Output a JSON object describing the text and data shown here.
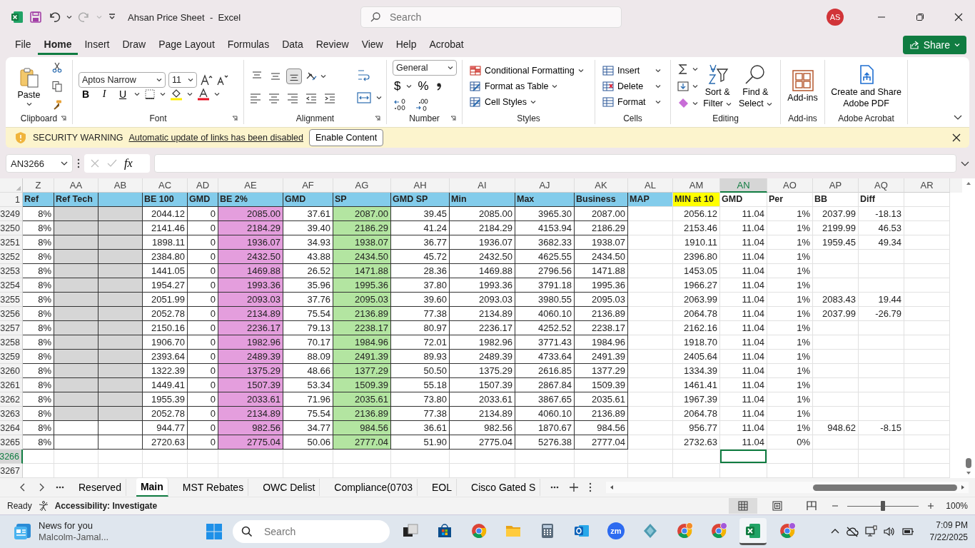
{
  "window": {
    "title": "Ahsan Price Sheet  -  Excel",
    "search_placeholder": "Search",
    "account_initials": "AS"
  },
  "menu_tabs": [
    {
      "label": "File",
      "selected": false
    },
    {
      "label": "Home",
      "selected": true
    },
    {
      "label": "Insert",
      "selected": false
    },
    {
      "label": "Draw",
      "selected": false
    },
    {
      "label": "Page Layout",
      "selected": false
    },
    {
      "label": "Formulas",
      "selected": false
    },
    {
      "label": "Data",
      "selected": false
    },
    {
      "label": "Review",
      "selected": false
    },
    {
      "label": "View",
      "selected": false
    },
    {
      "label": "Help",
      "selected": false
    },
    {
      "label": "Acrobat",
      "selected": false
    }
  ],
  "share_button": "Share",
  "ribbon": {
    "clipboard": {
      "paste": "Paste",
      "label": "Clipboard"
    },
    "font": {
      "family": "Aptos Narrow",
      "size": "11",
      "bold": "B",
      "italic": "I",
      "underline": "U",
      "label": "Font"
    },
    "alignment": {
      "label": "Alignment",
      "vertical": [
        {
          "selected": false
        },
        {
          "selected": false
        },
        {
          "selected": true
        }
      ]
    },
    "number": {
      "format": "General",
      "currency": "$",
      "percent": "%",
      "label": "Number"
    },
    "styles": {
      "items": [
        "Conditional Formatting",
        "Format as Table",
        "Cell Styles"
      ],
      "label": "Styles"
    },
    "cells": {
      "items": [
        "Insert",
        "Delete",
        "Format"
      ],
      "label": "Cells"
    },
    "editing": {
      "sort": [
        "Sort &",
        "Filter"
      ],
      "find": [
        "Find &",
        "Select"
      ],
      "label": "Editing"
    },
    "addins": {
      "button": "Add-ins",
      "label": "Add-ins"
    },
    "acrobat": {
      "button": [
        "Create and Share",
        "Adobe PDF"
      ],
      "label": "Adobe Acrobat"
    }
  },
  "security_bar": {
    "title": "SECURITY WARNING",
    "message": "Automatic update of links has been disabled",
    "button": "Enable Content"
  },
  "formula_bar": {
    "name_box": "AN3266",
    "fx": "fx"
  },
  "sheet": {
    "columns": [
      {
        "letter": "Z",
        "selected": false
      },
      {
        "letter": "AA",
        "selected": false
      },
      {
        "letter": "AB",
        "selected": false
      },
      {
        "letter": "AC",
        "selected": false
      },
      {
        "letter": "AD",
        "selected": false
      },
      {
        "letter": "AE",
        "selected": false,
        "color": "#e49edd"
      },
      {
        "letter": "AF",
        "selected": false
      },
      {
        "letter": "AG",
        "selected": false,
        "color": "#b3e5a1"
      },
      {
        "letter": "AH",
        "selected": false
      },
      {
        "letter": "AI",
        "selected": false
      },
      {
        "letter": "AJ",
        "selected": false
      },
      {
        "letter": "AK",
        "selected": false
      },
      {
        "letter": "AL",
        "selected": false
      },
      {
        "letter": "AM",
        "selected": false
      },
      {
        "letter": "AN",
        "selected": true
      },
      {
        "letter": "AO",
        "selected": false
      },
      {
        "letter": "AP",
        "selected": false
      },
      {
        "letter": "AQ",
        "selected": false
      },
      {
        "letter": "AR",
        "selected": false
      }
    ],
    "header_row": {
      "number": "1",
      "cells": [
        {
          "text": "Ref",
          "color": "#83cceb"
        },
        {
          "text": "Ref Tech",
          "color": "#83cceb"
        },
        {
          "color": "#83cceb"
        },
        {
          "text": "BE 100",
          "color": "#83cceb"
        },
        {
          "text": "GMD",
          "color": "#83cceb"
        },
        {
          "text": "BE 2%",
          "color": "#83cceb"
        },
        {
          "text": "GMD",
          "color": "#83cceb"
        },
        {
          "text": "SP",
          "color": "#83cceb"
        },
        {
          "text": "GMD SP",
          "color": "#83cceb"
        },
        {
          "text": "Min",
          "color": "#83cceb"
        },
        {
          "text": "Max",
          "color": "#83cceb"
        },
        {
          "text": "Business",
          "color": "#83cceb"
        },
        {
          "text": "MAP",
          "color": "#83cceb"
        },
        {
          "text": "MIN at 10",
          "color": "#ffff00"
        },
        {
          "text": "GMD"
        },
        {
          "text": "Per"
        },
        {
          "text": "BB"
        },
        {
          "text": "Diff"
        },
        {}
      ]
    },
    "rows": [
      {
        "number": "3249",
        "selected": false,
        "shaded": true,
        "cells": [
          "8%",
          null,
          null,
          "2044.12",
          "0",
          "2085.00",
          "37.61",
          "2087.00",
          "39.45",
          "2085.00",
          "3965.30",
          "2087.00",
          null,
          "2056.12",
          "11.04",
          "1%",
          "2037.99",
          "-18.13",
          null
        ]
      },
      {
        "number": "3250",
        "selected": false,
        "shaded": true,
        "cells": [
          "8%",
          null,
          null,
          "2141.46",
          "0",
          "2184.29",
          "39.40",
          "2186.29",
          "41.24",
          "2184.29",
          "4153.94",
          "2186.29",
          null,
          "2153.46",
          "11.04",
          "1%",
          "2199.99",
          "46.53",
          null
        ]
      },
      {
        "number": "3251",
        "selected": false,
        "shaded": true,
        "cells": [
          "8%",
          null,
          null,
          "1898.11",
          "0",
          "1936.07",
          "34.93",
          "1938.07",
          "36.77",
          "1936.07",
          "3682.33",
          "1938.07",
          null,
          "1910.11",
          "11.04",
          "1%",
          "1959.45",
          "49.34",
          null
        ]
      },
      {
        "number": "3252",
        "selected": false,
        "shaded": true,
        "cells": [
          "8%",
          null,
          null,
          "2384.80",
          "0",
          "2432.50",
          "43.88",
          "2434.50",
          "45.72",
          "2432.50",
          "4625.55",
          "2434.50",
          null,
          "2396.80",
          "11.04",
          "1%",
          null,
          null,
          null
        ]
      },
      {
        "number": "3253",
        "selected": false,
        "shaded": true,
        "cells": [
          "8%",
          null,
          null,
          "1441.05",
          "0",
          "1469.88",
          "26.52",
          "1471.88",
          "28.36",
          "1469.88",
          "2796.56",
          "1471.88",
          null,
          "1453.05",
          "11.04",
          "1%",
          null,
          null,
          null
        ]
      },
      {
        "number": "3254",
        "selected": false,
        "shaded": true,
        "cells": [
          "8%",
          null,
          null,
          "1954.27",
          "0",
          "1993.36",
          "35.96",
          "1995.36",
          "37.80",
          "1993.36",
          "3791.18",
          "1995.36",
          null,
          "1966.27",
          "11.04",
          "1%",
          null,
          null,
          null
        ]
      },
      {
        "number": "3255",
        "selected": false,
        "shaded": true,
        "cells": [
          "8%",
          null,
          null,
          "2051.99",
          "0",
          "2093.03",
          "37.76",
          "2095.03",
          "39.60",
          "2093.03",
          "3980.55",
          "2095.03",
          null,
          "2063.99",
          "11.04",
          "1%",
          "2083.43",
          "19.44",
          null
        ]
      },
      {
        "number": "3256",
        "selected": false,
        "shaded": true,
        "cells": [
          "8%",
          null,
          null,
          "2052.78",
          "0",
          "2134.89",
          "75.54",
          "2136.89",
          "77.38",
          "2134.89",
          "4060.10",
          "2136.89",
          null,
          "2064.78",
          "11.04",
          "1%",
          "2037.99",
          "-26.79",
          null
        ]
      },
      {
        "number": "3257",
        "selected": false,
        "shaded": true,
        "cells": [
          "8%",
          null,
          null,
          "2150.16",
          "0",
          "2236.17",
          "79.13",
          "2238.17",
          "80.97",
          "2236.17",
          "4252.52",
          "2238.17",
          null,
          "2162.16",
          "11.04",
          "1%",
          null,
          null,
          null
        ]
      },
      {
        "number": "3258",
        "selected": false,
        "shaded": true,
        "cells": [
          "8%",
          null,
          null,
          "1906.70",
          "0",
          "1982.96",
          "70.17",
          "1984.96",
          "72.01",
          "1982.96",
          "3771.43",
          "1984.96",
          null,
          "1918.70",
          "11.04",
          "1%",
          null,
          null,
          null
        ]
      },
      {
        "number": "3259",
        "selected": false,
        "shaded": true,
        "cells": [
          "8%",
          null,
          null,
          "2393.64",
          "0",
          "2489.39",
          "88.09",
          "2491.39",
          "89.93",
          "2489.39",
          "4733.64",
          "2491.39",
          null,
          "2405.64",
          "11.04",
          "1%",
          null,
          null,
          null
        ]
      },
      {
        "number": "3260",
        "selected": false,
        "shaded": true,
        "cells": [
          "8%",
          null,
          null,
          "1322.39",
          "0",
          "1375.29",
          "48.66",
          "1377.29",
          "50.50",
          "1375.29",
          "2616.85",
          "1377.29",
          null,
          "1334.39",
          "11.04",
          "1%",
          null,
          null,
          null
        ]
      },
      {
        "number": "3261",
        "selected": false,
        "shaded": true,
        "cells": [
          "8%",
          null,
          null,
          "1449.41",
          "0",
          "1507.39",
          "53.34",
          "1509.39",
          "55.18",
          "1507.39",
          "2867.84",
          "1509.39",
          null,
          "1461.41",
          "11.04",
          "1%",
          null,
          null,
          null
        ]
      },
      {
        "number": "3262",
        "selected": false,
        "shaded": true,
        "cells": [
          "8%",
          null,
          null,
          "1955.39",
          "0",
          "2033.61",
          "71.96",
          "2035.61",
          "73.80",
          "2033.61",
          "3867.65",
          "2035.61",
          null,
          "1967.39",
          "11.04",
          "1%",
          null,
          null,
          null
        ]
      },
      {
        "number": "3263",
        "selected": false,
        "shaded": true,
        "cells": [
          "8%",
          null,
          null,
          "2052.78",
          "0",
          "2134.89",
          "75.54",
          "2136.89",
          "77.38",
          "2134.89",
          "4060.10",
          "2136.89",
          null,
          "2064.78",
          "11.04",
          "1%",
          null,
          null,
          null
        ]
      },
      {
        "number": "3264",
        "selected": false,
        "shaded": false,
        "cells": [
          "8%",
          null,
          null,
          "944.77",
          "0",
          "982.56",
          "34.77",
          "984.56",
          "36.61",
          "982.56",
          "1870.67",
          "984.56",
          null,
          "956.77",
          "11.04",
          "1%",
          "948.62",
          "-8.15",
          null
        ]
      },
      {
        "number": "3265",
        "selected": false,
        "shaded": false,
        "cells": [
          "8%",
          null,
          null,
          "2720.63",
          "0",
          "2775.04",
          "50.06",
          "2777.04",
          "51.90",
          "2775.04",
          "5276.38",
          "2777.04",
          null,
          "2732.63",
          "11.04",
          "0%",
          null,
          null,
          null
        ]
      },
      {
        "number": "3266",
        "selected": true,
        "shaded": false
      },
      {
        "number": "3267",
        "selected": false,
        "shaded": false
      }
    ]
  },
  "sheet_tabs": [
    {
      "label": "Reserved",
      "selected": false
    },
    {
      "label": "Main",
      "selected": true
    },
    {
      "label": "MST Rebates",
      "selected": false
    },
    {
      "label": "OWC Delist",
      "selected": false
    },
    {
      "label": "Compliance(0703",
      "selected": false
    },
    {
      "label": "EOL",
      "selected": false
    },
    {
      "label": "Cisco Gated S",
      "selected": false
    }
  ],
  "status_bar": {
    "mode": "Ready",
    "accessibility": "Accessibility: Investigate",
    "views": [
      {
        "kind": "normal",
        "selected": true
      },
      {
        "kind": "page_layout",
        "selected": false
      },
      {
        "kind": "page_break",
        "selected": false
      }
    ],
    "zoom": {
      "level": 0.5,
      "reading": "100%"
    }
  },
  "taskbar": {
    "news_title": "News for you",
    "news_subtitle": "Malcolm-Jamal...",
    "search_placeholder": "Search",
    "apps": [
      {
        "kind": "task_view",
        "active": false
      },
      {
        "kind": "store",
        "active": false
      },
      {
        "kind": "chrome",
        "active": false
      },
      {
        "kind": "folder",
        "active": false
      },
      {
        "kind": "calculator",
        "active": false
      },
      {
        "kind": "outlook",
        "active": false
      },
      {
        "kind": "zoom",
        "active": false,
        "label": "zm"
      },
      {
        "kind": "diamond",
        "active": false
      },
      {
        "kind": "chrome_badge",
        "active": false,
        "color": "#f28c28"
      },
      {
        "kind": "chrome_badge",
        "active": false,
        "color": "#a259d9"
      },
      {
        "kind": "excel",
        "active": true
      },
      {
        "kind": "chrome_badge",
        "active": false,
        "color": "#a259d9"
      }
    ],
    "time": "7:09 PM",
    "date": "7/22/2025"
  }
}
